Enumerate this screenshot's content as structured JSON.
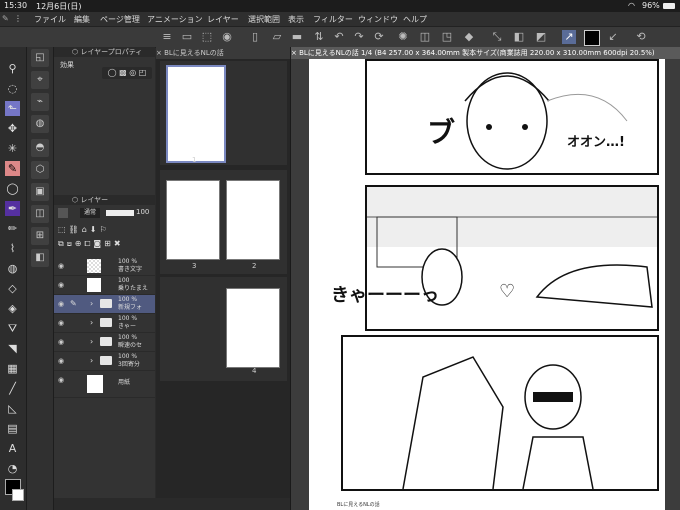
{
  "status": {
    "time": "15:30",
    "date": "12月6日(日)",
    "battery": "96%"
  },
  "menu": [
    "ファイル",
    "編集",
    "ページ管理",
    "アニメーション",
    "レイヤー",
    "選択範囲",
    "表示",
    "フィルター",
    "ウィンドウ",
    "ヘルプ"
  ],
  "layer_property": {
    "title": "レイヤープロパティ",
    "effect_label": "効果"
  },
  "layer_panel": {
    "title": "レイヤー",
    "blend_mode": "通常",
    "opacity": "100",
    "layers": [
      {
        "opacity": "100 %",
        "name": "書き文字",
        "kind": "raster"
      },
      {
        "opacity": "100",
        "name": "乗りたまえ",
        "kind": "raster"
      },
      {
        "opacity": "100 %",
        "name": "新規フォ",
        "kind": "folder",
        "selected": true
      },
      {
        "opacity": "100 %",
        "name": "きゃー",
        "kind": "folder"
      },
      {
        "opacity": "100 %",
        "name": "瞬速のセ",
        "kind": "folder"
      },
      {
        "opacity": "100 %",
        "name": "3回寄分",
        "kind": "folder"
      },
      {
        "opacity": "",
        "name": "用紙",
        "kind": "paper"
      }
    ]
  },
  "page_manager": {
    "tab": "BLに見えるNLの話",
    "pages": [
      "1",
      "2",
      "3",
      "4"
    ]
  },
  "canvas": {
    "tab": "BLに見えるNLの話 1/4 (B4 257.00 x 364.00mm 製本サイズ(商業誌用 220.00 x 310.00mm 600dpi 20.5%)",
    "sfx": {
      "top": "ブ",
      "onomatopoeia": "オオン…!",
      "scream": "きゃーーーっ",
      "heart": "♡"
    },
    "credit": "BLに見えるNLの話"
  }
}
